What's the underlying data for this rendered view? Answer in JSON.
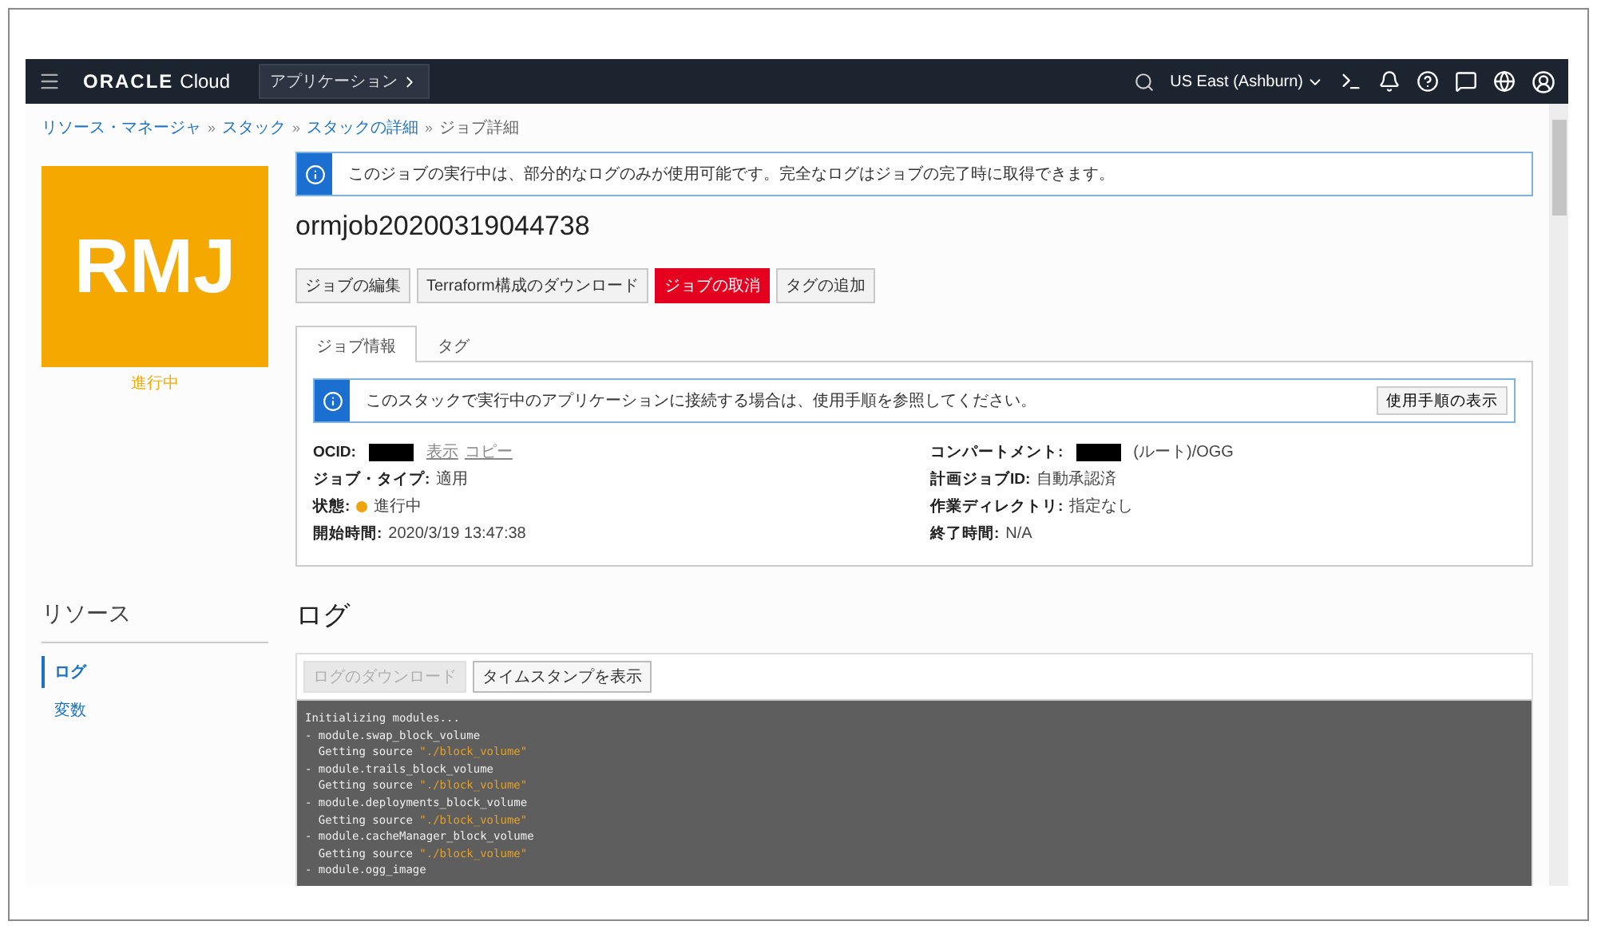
{
  "header": {
    "logo_brand": "ORACLE",
    "logo_product": "Cloud",
    "apps_button": "アプリケーション",
    "region": "US East (Ashburn)"
  },
  "breadcrumb_separator": "»",
  "breadcrumbs": [
    {
      "label": "リソース・マネージャ",
      "link": true
    },
    {
      "label": "スタック",
      "link": true
    },
    {
      "label": "スタックの詳細",
      "link": true
    },
    {
      "label": "ジョブ詳細",
      "link": false
    }
  ],
  "badge": {
    "initials": "RMJ",
    "status": "進行中"
  },
  "resources": {
    "title": "リソース",
    "items": [
      {
        "label": "ログ",
        "selected": true
      },
      {
        "label": "変数",
        "selected": false
      }
    ]
  },
  "notice": "このジョブの実行中は、部分的なログのみが使用可能です。完全なログはジョブの完了時に取得できます。",
  "title": "ormjob20200319044738",
  "actions": [
    {
      "label": "ジョブの編集",
      "kind": "default"
    },
    {
      "label": "Terraform構成のダウンロード",
      "kind": "default"
    },
    {
      "label": "ジョブの取消",
      "kind": "danger"
    },
    {
      "label": "タグの追加",
      "kind": "default"
    }
  ],
  "tabs": [
    {
      "label": "ジョブ情報",
      "selected": true
    },
    {
      "label": "タグ",
      "selected": false
    }
  ],
  "info_banner": {
    "text": "このスタックで実行中のアプリケーションに接続する場合は、使用手順を参照してください。",
    "button": "使用手順の表示"
  },
  "details_left": [
    {
      "label": "OCID:",
      "redacted": true,
      "links": [
        "表示",
        "コピー"
      ]
    },
    {
      "label": "ジョブ・タイプ:",
      "value": "適用"
    },
    {
      "label": "状態:",
      "value": "進行中",
      "color": "#f0a30a"
    },
    {
      "label": "開始時間:",
      "value": "2020/3/19 13:47:38"
    }
  ],
  "details_right": [
    {
      "label": "コンパートメント:",
      "redacted": true,
      "value": "(ルート)/OGG"
    },
    {
      "label": "計画ジョブID:",
      "value": "自動承認済"
    },
    {
      "label": "作業ディレクトリ:",
      "value": "指定なし"
    },
    {
      "label": "終了時間:",
      "value": "N/A"
    }
  ],
  "log": {
    "title": "ログ",
    "buttons": [
      {
        "label": "ログのダウンロード",
        "disabled": true
      },
      {
        "label": "タイムスタンプを表示",
        "disabled": false
      }
    ],
    "lines": [
      [
        {
          "text": "Initializing modules..."
        }
      ],
      [
        {
          "text": "- module.swap_block_volume"
        }
      ],
      [
        {
          "text": "  Getting source "
        },
        {
          "text": "\"./block_volume\"",
          "kind": "string"
        }
      ],
      [
        {
          "text": "- module.trails_block_volume"
        }
      ],
      [
        {
          "text": "  Getting source "
        },
        {
          "text": "\"./block_volume\"",
          "kind": "string"
        }
      ],
      [
        {
          "text": "- module.deployments_block_volume"
        }
      ],
      [
        {
          "text": "  Getting source "
        },
        {
          "text": "\"./block_volume\"",
          "kind": "string"
        }
      ],
      [
        {
          "text": "- module.cacheManager_block_volume"
        }
      ],
      [
        {
          "text": "  Getting source "
        },
        {
          "text": "\"./block_volume\"",
          "kind": "string"
        }
      ],
      [
        {
          "text": "- module.ogg_image"
        }
      ]
    ]
  }
}
